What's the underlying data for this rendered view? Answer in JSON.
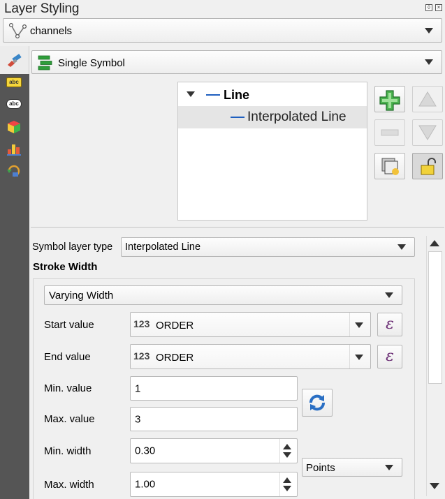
{
  "window": {
    "title": "Layer Styling"
  },
  "layer_select": {
    "value": "channels"
  },
  "renderer_select": {
    "value": "Single Symbol"
  },
  "sidebar": {
    "items": [
      {
        "icon": "paintbrush-icon"
      },
      {
        "icon": "labels-icon",
        "text": "abc"
      },
      {
        "icon": "masks-icon",
        "text": "abc"
      },
      {
        "icon": "3d-view-icon"
      },
      {
        "icon": "diagrams-icon"
      },
      {
        "icon": "history-icon"
      }
    ]
  },
  "symbol_tree": {
    "items": [
      {
        "label": "Line",
        "bold": true
      },
      {
        "label": "Interpolated Line",
        "selected": true
      }
    ]
  },
  "symbol_layer": {
    "type_label": "Symbol layer type",
    "type_value": "Interpolated Line"
  },
  "stroke_width": {
    "heading": "Stroke Width",
    "mode_value": "Varying Width",
    "start_value_label": "Start value",
    "start_value_prefix": "123",
    "start_value_field": "ORDER",
    "end_value_label": "End value",
    "end_value_prefix": "123",
    "end_value_field": "ORDER",
    "min_value_label": "Min. value",
    "min_value": "1",
    "max_value_label": "Max. value",
    "max_value": "3",
    "min_width_label": "Min. width",
    "min_width": "0.30",
    "max_width_label": "Max. width",
    "max_width": "1.00",
    "unit_value": "Points"
  },
  "colors": {
    "accent_blue": "#1f5fbf",
    "sidebar_bg": "#555555",
    "plus_green": "#2e9e3a",
    "lock_yellow": "#f1d23a"
  }
}
